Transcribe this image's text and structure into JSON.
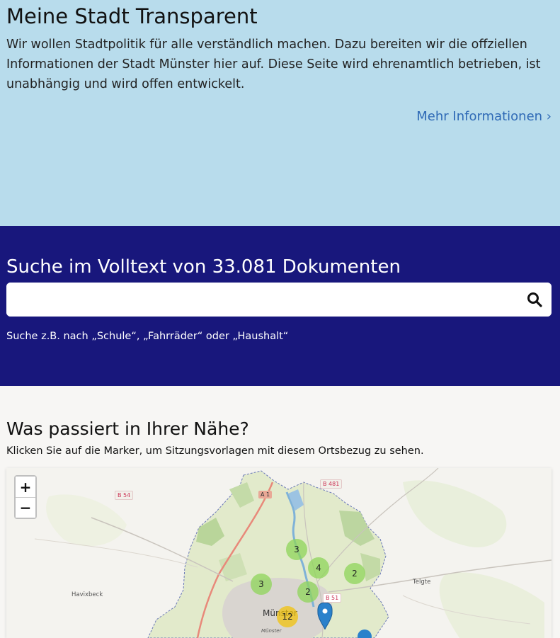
{
  "hero": {
    "title": "Meine Stadt Transparent",
    "intro": "Wir wollen Stadtpolitik für alle verständlich machen. Dazu bereiten wir die offziellen Informationen der Stadt Münster hier auf. Diese Seite wird ehrenamtlich betrieben, ist unabhängig und wird offen entwickelt.",
    "more_link": "Mehr Informationen ›"
  },
  "search": {
    "title": "Suche im Volltext von 33.081 Dokumenten",
    "placeholder": "",
    "hint": "Suche z.B. nach „Schule“, „Fahrräder“ oder „Haushalt“"
  },
  "near": {
    "title": "Was passiert in Ihrer Nähe?",
    "subtitle": "Klicken Sie auf die Marker, um Sitzungsvorlagen mit diesem Ortsbezug zu sehen."
  },
  "map": {
    "zoom_in": "+",
    "zoom_out": "−",
    "labels": {
      "havixbeck": "Havixbeck",
      "telgte": "Telgte",
      "muenster": "Münster",
      "muenster_small": "Münster"
    },
    "roads": {
      "a1": "A 1",
      "b481": "B 481",
      "b54": "B 54",
      "b51": "B 51"
    },
    "clusters": [
      {
        "count": "3",
        "color": "green"
      },
      {
        "count": "4",
        "color": "green"
      },
      {
        "count": "2",
        "color": "green"
      },
      {
        "count": "3",
        "color": "green"
      },
      {
        "count": "2",
        "color": "green"
      },
      {
        "count": "12",
        "color": "yellow"
      }
    ],
    "colors": {
      "city_fill": "#e6ecd2",
      "urban": "#d9d5d0",
      "water": "#7fb2d8",
      "marker": "#2a81cb",
      "highway": "#e8897a"
    }
  }
}
